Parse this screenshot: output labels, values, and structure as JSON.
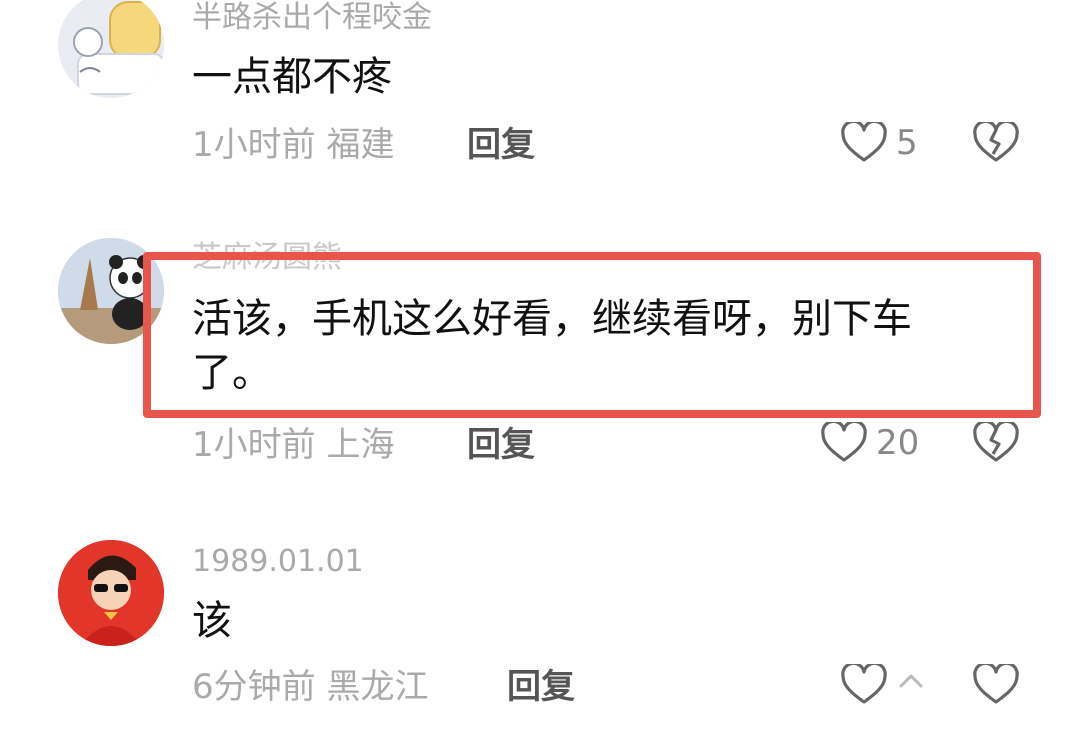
{
  "comments": [
    {
      "username": "半路杀出个程咬金",
      "text_lines": [
        "一点都不疼"
      ],
      "time": "1小时前",
      "location": "福建",
      "reply_label": "回复",
      "like_count": "5",
      "avatar_icon": "bread-cartoon-avatar"
    },
    {
      "username": "芝麻汤圆熊",
      "text_lines": [
        "活该，手机这么好看，继续看呀，别下车",
        "了。"
      ],
      "time": "1小时前",
      "location": "上海",
      "reply_label": "回复",
      "like_count": "20",
      "avatar_icon": "panda-avatar"
    },
    {
      "username": "1989.01.01",
      "text_lines": [
        "该"
      ],
      "time": "6分钟前",
      "location": "黑龙江",
      "reply_label": "回复",
      "like_count": "",
      "avatar_icon": "cartoon-boy-red-avatar"
    }
  ],
  "colors": {
    "highlight": "#e8564b",
    "muted": "#aaaaaa",
    "text": "#111111"
  }
}
